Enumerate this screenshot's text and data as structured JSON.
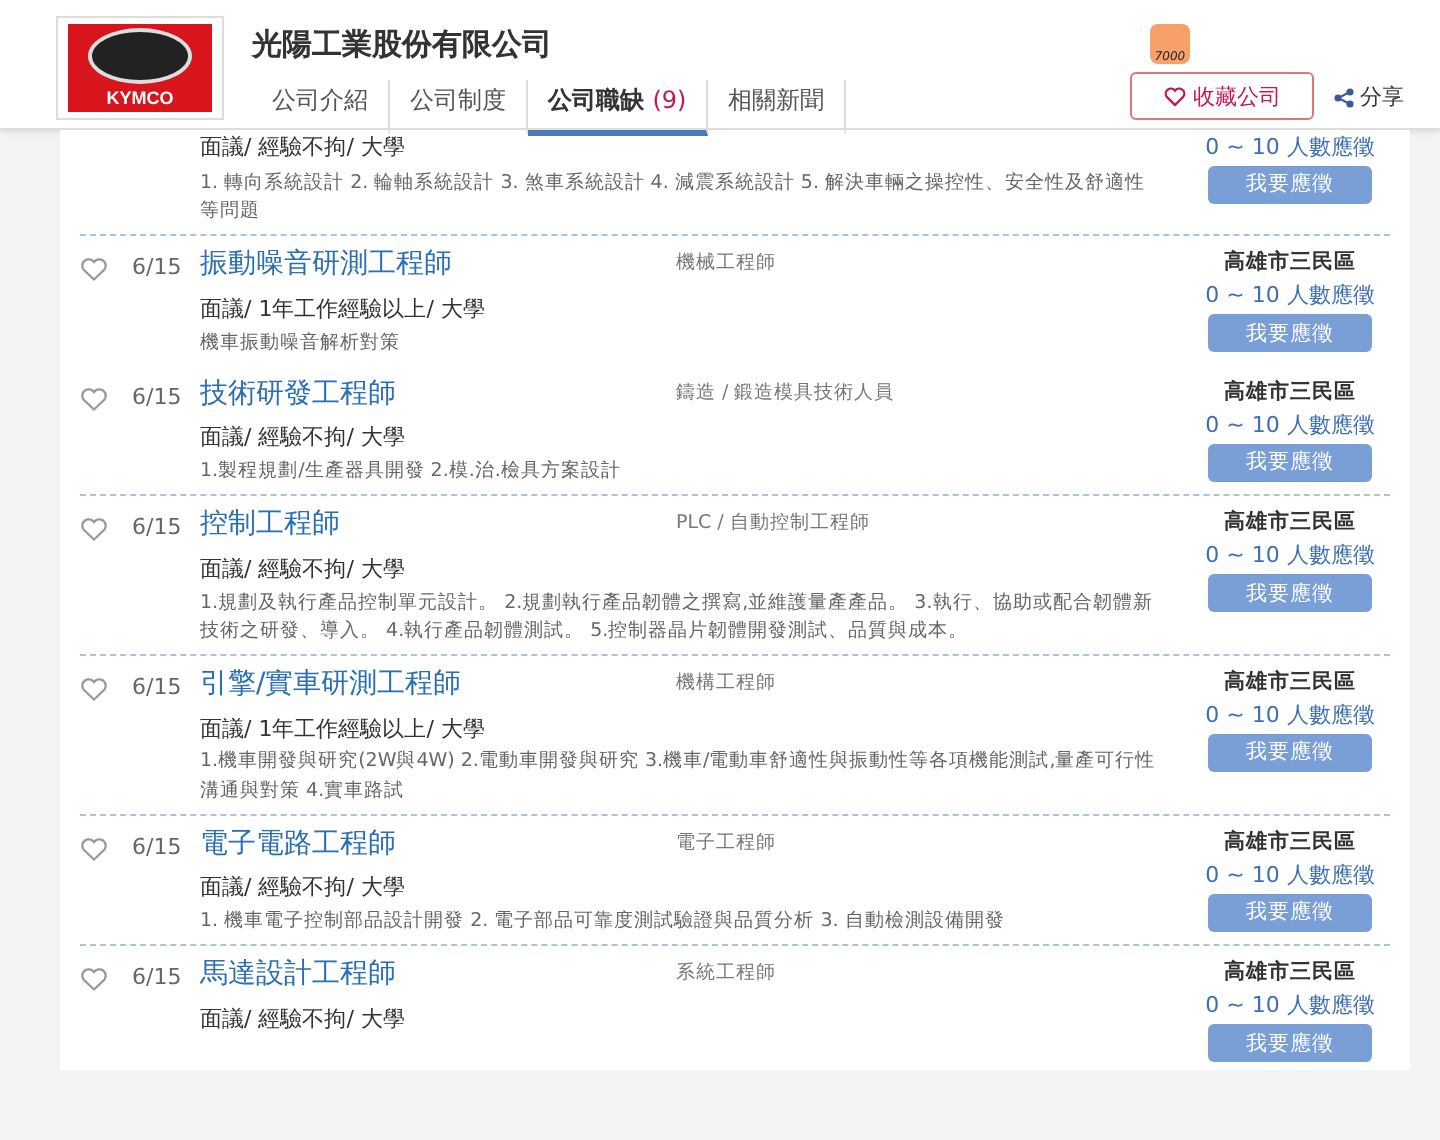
{
  "company": {
    "logo_text": "KYMCO",
    "name": "光陽工業股份有限公司",
    "badge": "7000"
  },
  "tabs": [
    {
      "label": "公司介紹",
      "selected": false
    },
    {
      "label": "公司制度",
      "selected": false
    },
    {
      "label": "公司職缺",
      "count": "(9)",
      "selected": true
    },
    {
      "label": "相關新聞",
      "selected": false
    }
  ],
  "follow_button": "收藏公司",
  "share": "分享",
  "jobs": [
    {
      "kind": "partial",
      "requirements": "面議/ 經驗不拘/ 大學",
      "description": "1. 轉向系統設計 2. 輪軸系統設計 3. 煞車系統設計 4. 減震系統設計 5. 解決車輛之操控性、安全性及舒適性等問題",
      "applicants": "0 ~ 10 人數應徵",
      "apply": "我要應徵",
      "divider": true
    },
    {
      "kind": "full",
      "date": "6/15",
      "title": "振動噪音研測工程師",
      "category": "機械工程師",
      "location": "高雄市三民區",
      "requirements": "面議/ 1年工作經驗以上/ 大學",
      "description": "機車振動噪音解析對策",
      "applicants": "0 ~ 10 人數應徵",
      "apply": "我要應徵",
      "divider": false
    },
    {
      "kind": "full",
      "date": "6/15",
      "title": "技術研發工程師",
      "category": "鑄造 / 鍛造模具技術人員",
      "location": "高雄市三民區",
      "requirements": "面議/ 經驗不拘/ 大學",
      "description": "1.製程規劃/生產器具開發 2.模.治.檢具方案設計",
      "applicants": "0 ~ 10 人數應徵",
      "apply": "我要應徵",
      "divider": true
    },
    {
      "kind": "full",
      "date": "6/15",
      "title": "控制工程師",
      "category": "PLC / 自動控制工程師",
      "location": "高雄市三民區",
      "requirements": "面議/ 經驗不拘/ 大學",
      "description": "1.規劃及執行產品控制單元設計。 2.規劃執行產品韌體之撰寫,並維護量產產品。 3.執行、協助或配合韌體新技術之研發、導入。 4.執行產品韌體測試。 5.控制器晶片韌體開發測試、品質與成本。",
      "applicants": "0 ~ 10 人數應徵",
      "apply": "我要應徵",
      "divider": true
    },
    {
      "kind": "full",
      "date": "6/15",
      "title": "引擎/實車研測工程師",
      "category": "機構工程師",
      "location": "高雄市三民區",
      "requirements": "面議/ 1年工作經驗以上/ 大學",
      "description": "1.機車開發與研究(2W與4W)  2.電動車開發與研究  3.機車/電動車舒適性與振動性等各項機能測試,量產可行性溝通與對策 4.實車路試",
      "applicants": "0 ~ 10 人數應徵",
      "apply": "我要應徵",
      "divider": true
    },
    {
      "kind": "full",
      "date": "6/15",
      "title": "電子電路工程師",
      "category": "電子工程師",
      "location": "高雄市三民區",
      "requirements": "面議/ 經驗不拘/ 大學",
      "description": "1. 機車電子控制部品設計開發 2. 電子部品可靠度測試驗證與品質分析 3. 自動檢測設備開發",
      "applicants": "0 ~ 10 人數應徵",
      "apply": "我要應徵",
      "divider": true
    },
    {
      "kind": "full",
      "date": "6/15",
      "title": "馬達設計工程師",
      "category": "系統工程師",
      "location": "高雄市三民區",
      "requirements": "面議/ 經驗不拘/ 大學",
      "applicants": "0 ~ 10 人數應徵",
      "apply": "我要應徵",
      "divider": false
    }
  ]
}
